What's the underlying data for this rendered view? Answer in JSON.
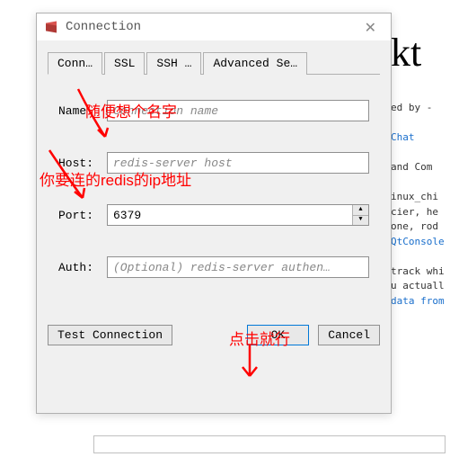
{
  "dialog": {
    "title": "Connection",
    "close_glyph": "✕",
    "tabs": [
      {
        "label": "Conn…"
      },
      {
        "label": "SSL"
      },
      {
        "label": "SSH …"
      },
      {
        "label": "Advanced Se…"
      }
    ],
    "fields": {
      "name_label": "Name",
      "name_placeholder": "Connection name",
      "host_label": "Host:",
      "host_placeholder": "redis-server host",
      "port_label": "Port:",
      "port_value": "6379",
      "auth_label": "Auth:",
      "auth_placeholder": "(Optional) redis-server authen…"
    },
    "buttons": {
      "test": "Test Connection",
      "ok": "OK",
      "cancel": "Cancel"
    }
  },
  "annotations": {
    "name_hint": "随便想个名字",
    "host_hint": "你要连的redis的ip地址",
    "ok_hint": "点击就行"
  },
  "background": {
    "large": "kt",
    "l1": "ed by -",
    "l2": "Chat",
    "l3": " and Com",
    "l4": "inux_chi",
    "l5": "cier, he",
    "l6": "one, rod",
    "l7": "QtConsole",
    "l8": "track whi",
    "l9": "u actuall",
    "l10": "data from"
  }
}
